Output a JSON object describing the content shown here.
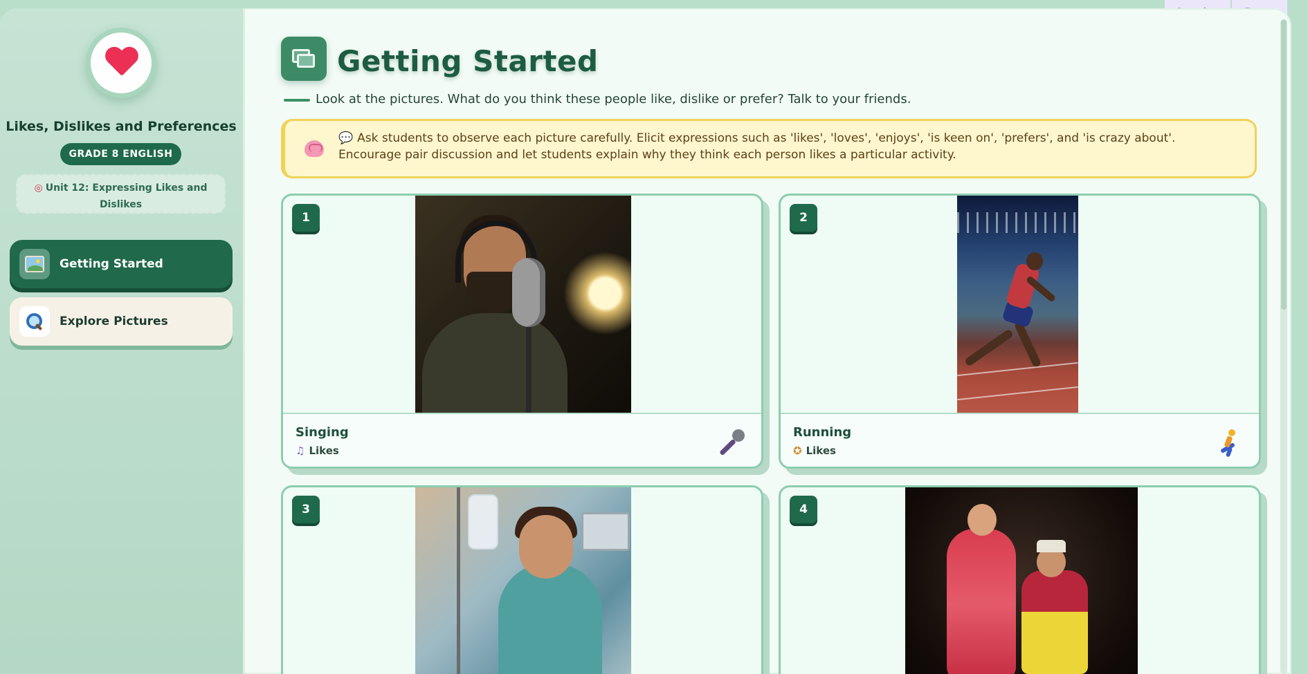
{
  "app": {
    "title": "Likes, Dislikes and Preferences",
    "grade": "GRADE 8 ENGLISH",
    "unit": "Unit 12: Expressing Likes and Dislikes"
  },
  "sidebar": {
    "items": [
      {
        "label": "Getting Started",
        "icon": "picture-icon",
        "active": true
      },
      {
        "label": "Explore Pictures",
        "icon": "magnifier-icon",
        "active": false
      }
    ]
  },
  "toolbar": {
    "overlay_label": "Overlay",
    "draw_label": "Draw"
  },
  "main": {
    "title": "Getting Started",
    "subtitle": "Look at the pictures. What do you think these people like, dislike or prefer? Talk to your friends.",
    "note": "Ask students to observe each picture carefully. Elicit expressions such as 'likes', 'loves', 'enjoys', 'is keen on', 'prefers', and 'is crazy about'. Encourage pair discussion and let students explain why they think each person likes a particular activity.",
    "cards": [
      {
        "num": "1",
        "activity": "Singing",
        "pref": "Likes",
        "pref_icon": "music-note-icon",
        "activity_icon": "microphone-icon"
      },
      {
        "num": "2",
        "activity": "Running",
        "pref": "Likes",
        "pref_icon": "medal-icon",
        "activity_icon": "runner-icon"
      },
      {
        "num": "3",
        "activity": "",
        "pref": ""
      },
      {
        "num": "4",
        "activity": "",
        "pref": ""
      }
    ]
  },
  "colors": {
    "accent": "#1f6a4c",
    "note_bg": "#fef6cd",
    "note_border": "#f0d256",
    "card_border": "#8ccdaf"
  }
}
